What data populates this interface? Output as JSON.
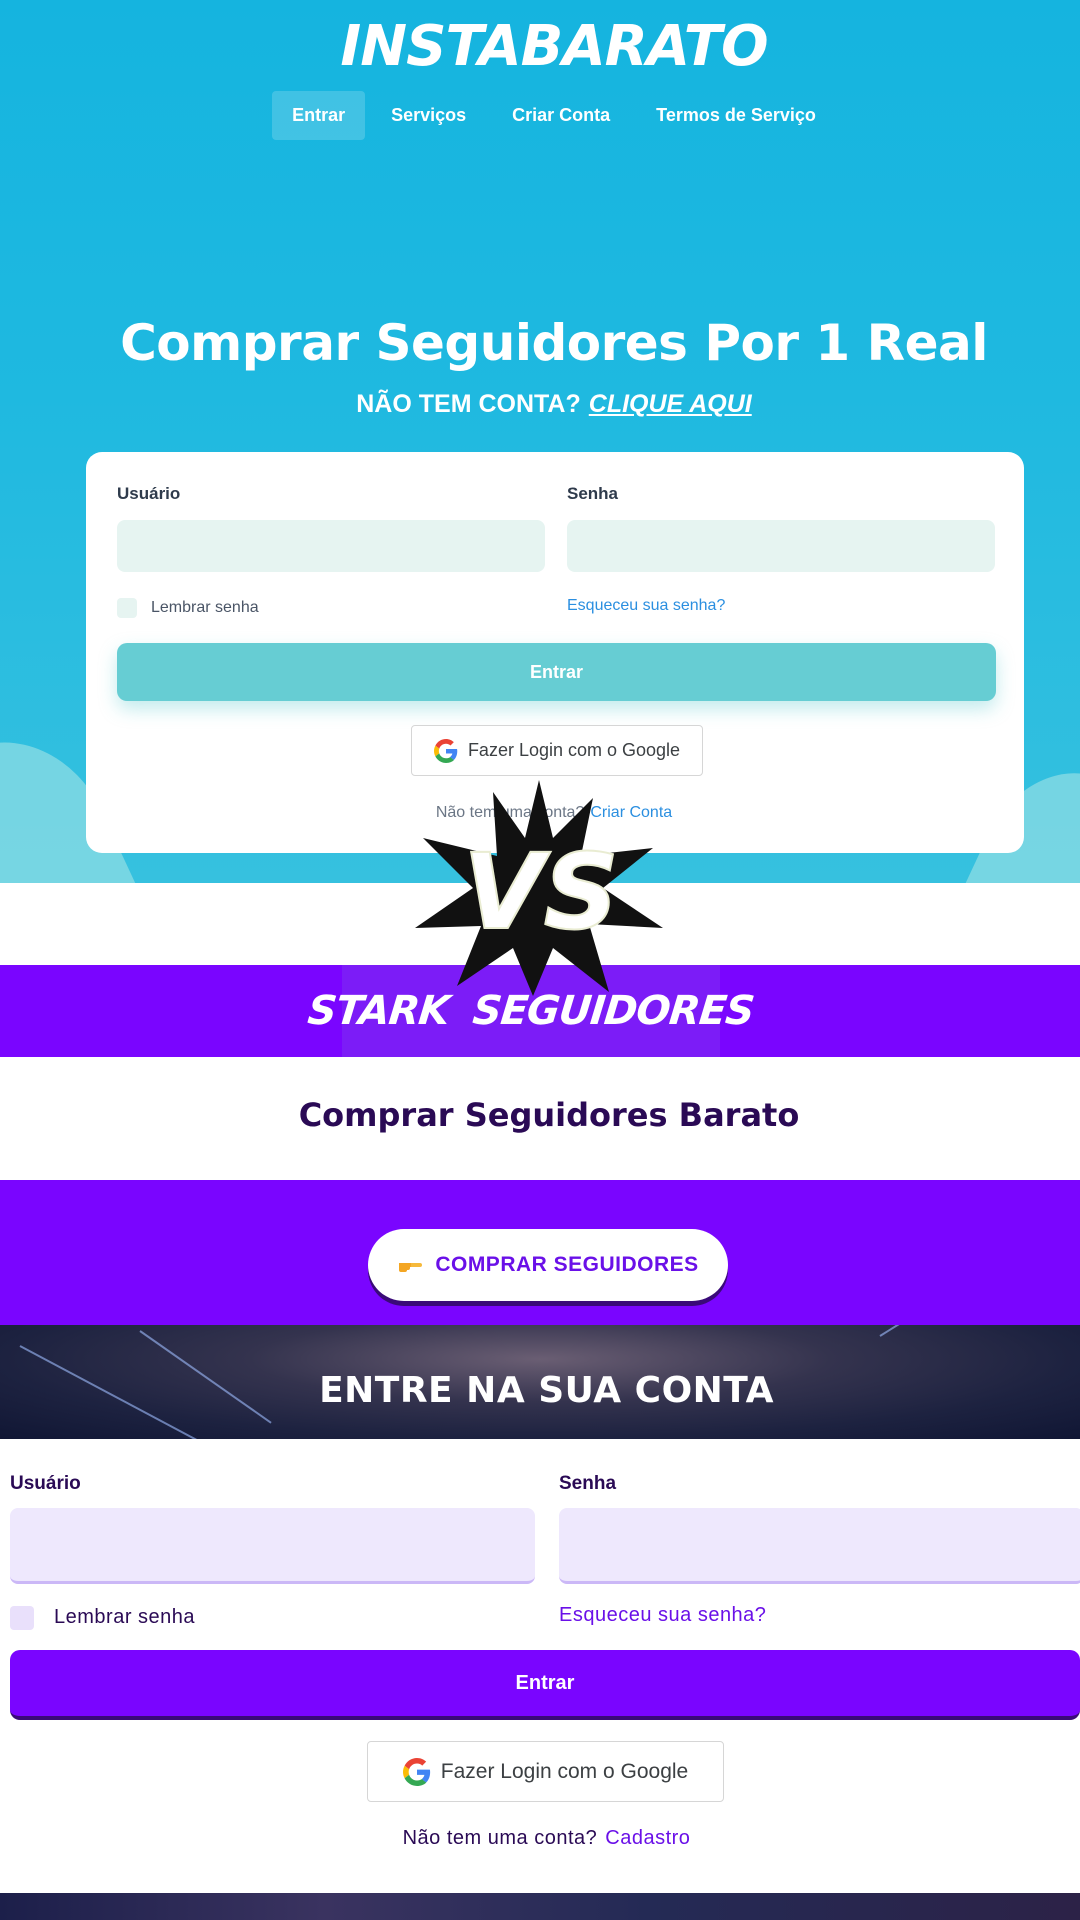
{
  "instabarato": {
    "logo": "INSTABARATO",
    "nav": [
      "Entrar",
      "Serviços",
      "Criar Conta",
      "Termos de Serviço"
    ],
    "hero_title": "Comprar Seguidores Por 1 Real",
    "hero_sub": "NÃO TEM CONTA?",
    "hero_sub_link": "CLIQUE AQUI",
    "form": {
      "user_label": "Usuário",
      "pass_label": "Senha",
      "remember": "Lembrar senha",
      "forgot": "Esqueceu sua senha?",
      "submit": "Entrar",
      "google": "Fazer Login com o Google",
      "footer_text": "Não tem uma conta?",
      "footer_link": "Criar Conta"
    }
  },
  "vs_badge": "VS",
  "stark": {
    "logo_left": "STARK",
    "logo_right": "SEGUIDORES",
    "title": "Comprar Seguidores Barato",
    "buy_button": "COMPRAR SEGUIDORES",
    "hero_title": "ENTRE NA SUA CONTA",
    "form": {
      "user_label": "Usuário",
      "pass_label": "Senha",
      "remember": "Lembrar senha",
      "forgot": "Esqueceu sua senha?",
      "submit": "Entrar",
      "google": "Fazer Login com o Google",
      "footer_text": "Não tem uma conta?",
      "footer_link": "Cadastro"
    }
  },
  "colors": {
    "insta_primary": "#15b4df",
    "insta_button": "#66cdd3",
    "stark_primary": "#7a05ff",
    "stark_text": "#2a0a55"
  }
}
